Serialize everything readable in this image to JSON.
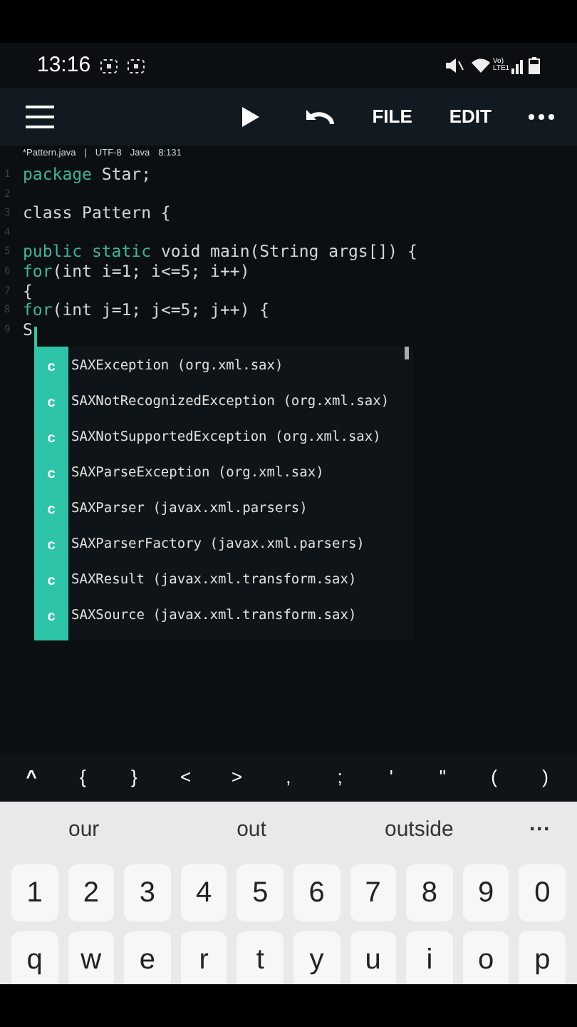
{
  "status_bar": {
    "time": "13:16",
    "network": "Vo) LTE1"
  },
  "toolbar": {
    "actions": [
      "FILE",
      "EDIT"
    ]
  },
  "file_info": {
    "file": "*Pattern.java",
    "separator": "|",
    "encoding": "UTF-8",
    "language": "Java",
    "position": "8:131"
  },
  "editor": {
    "lines": [
      {
        "number": "1",
        "tokens": [
          {
            "text": "package",
            "kind": "keyword"
          },
          {
            "text": " Star;",
            "kind": "plain"
          }
        ]
      },
      {
        "number": "2"
      },
      {
        "number": "3",
        "tokens": [
          {
            "text": "class Pattern {",
            "kind": "plain"
          }
        ]
      },
      {
        "number": "4"
      },
      {
        "number": "5",
        "tokens": [
          {
            "text": "public static",
            "kind": "keyword"
          },
          {
            "text": " void main(String args[]) {",
            "kind": "plain"
          }
        ]
      },
      {
        "number": "6",
        "tokens": [
          {
            "text": "for",
            "kind": "keyword"
          },
          {
            "text": "(int i=1; i<=5; i++)",
            "kind": "plain"
          }
        ]
      },
      {
        "number": "7",
        "tokens": [
          {
            "text": "{",
            "kind": "plain"
          }
        ]
      },
      {
        "number": "8",
        "tokens": [
          {
            "text": "for",
            "kind": "keyword"
          },
          {
            "text": "(int j=1; j<=5; j++) {",
            "kind": "plain"
          }
        ]
      },
      {
        "number": "9",
        "tokens": [
          {
            "text": "S",
            "kind": "plain"
          }
        ]
      }
    ]
  },
  "autocomplete": [
    {
      "badge": "c",
      "label": "SAXException (org.xml.sax)"
    },
    {
      "badge": "c",
      "label": "SAXNotRecognizedException (org.xml.sax)"
    },
    {
      "badge": "c",
      "label": "SAXNotSupportedException (org.xml.sax)"
    },
    {
      "badge": "c",
      "label": "SAXParseException (org.xml.sax)"
    },
    {
      "badge": "c",
      "label": "SAXParser (javax.xml.parsers)"
    },
    {
      "badge": "c",
      "label": "SAXParserFactory (javax.xml.parsers)"
    },
    {
      "badge": "c",
      "label": "SAXResult (javax.xml.transform.sax)"
    },
    {
      "badge": "c",
      "label": "SAXSource (javax.xml.transform.sax)"
    }
  ],
  "symbol_bar": [
    "^",
    "{",
    "}",
    "<",
    ">",
    ",",
    ";",
    "'",
    "\"",
    "(",
    ")"
  ],
  "suggestions": [
    "our",
    "out",
    "outside",
    "···"
  ],
  "keyboard": {
    "rows": [
      [
        "1",
        "2",
        "3",
        "4",
        "5",
        "6",
        "7",
        "8",
        "9",
        "0"
      ],
      [
        "q",
        "w",
        "e",
        "r",
        "t",
        "y",
        "u",
        "i",
        "o",
        "p"
      ]
    ]
  }
}
